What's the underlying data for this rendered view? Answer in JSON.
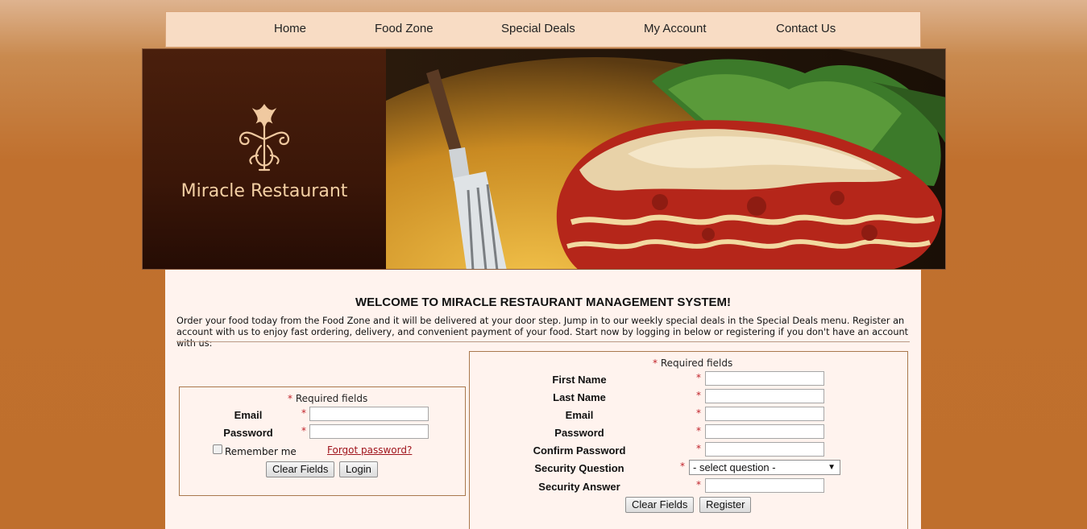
{
  "nav": {
    "items": [
      {
        "label": "Home"
      },
      {
        "label": "Food Zone"
      },
      {
        "label": "Special Deals"
      },
      {
        "label": "My Account"
      },
      {
        "label": "Contact Us"
      }
    ]
  },
  "banner": {
    "title": "Miracle Restaurant",
    "logo_icon": "floral-emblem-icon",
    "photo_icon": "lasagna-photo"
  },
  "main": {
    "heading": "WELCOME TO MIRACLE RESTAURANT MANAGEMENT SYSTEM!",
    "intro": "Order your food today from the Food Zone and it will be delivered at your door step. Jump in to our weekly special deals in the Special Deals menu. Register an account with us to enjoy fast ordering, delivery, and convenient payment of your food. Start now by logging in below or registering if you don't have an account with us:"
  },
  "login": {
    "required_mark": "*",
    "required_text": "Required fields",
    "email_label": "Email",
    "email_value": "",
    "password_label": "Password",
    "password_value": "",
    "remember_label": "Remember me",
    "remember_checked": false,
    "forgot_link": "Forgot password?",
    "clear_button": "Clear Fields",
    "login_button": "Login"
  },
  "register": {
    "required_mark": "*",
    "required_text": "Required fields",
    "first_name_label": "First Name",
    "last_name_label": "Last Name",
    "email_label": "Email",
    "password_label": "Password",
    "confirm_password_label": "Confirm Password",
    "security_question_label": "Security Question",
    "security_question_selected": "- select question -",
    "security_answer_label": "Security Answer",
    "clear_button": "Clear Fields",
    "register_button": "Register"
  },
  "colors": {
    "nav_bg": "#f8dcc4",
    "page_bg": "#bf6f2c",
    "content_bg": "#fff3ee",
    "required_star": "#c0232b",
    "link": "#a0141c",
    "banner_title": "#f3cfa3"
  }
}
